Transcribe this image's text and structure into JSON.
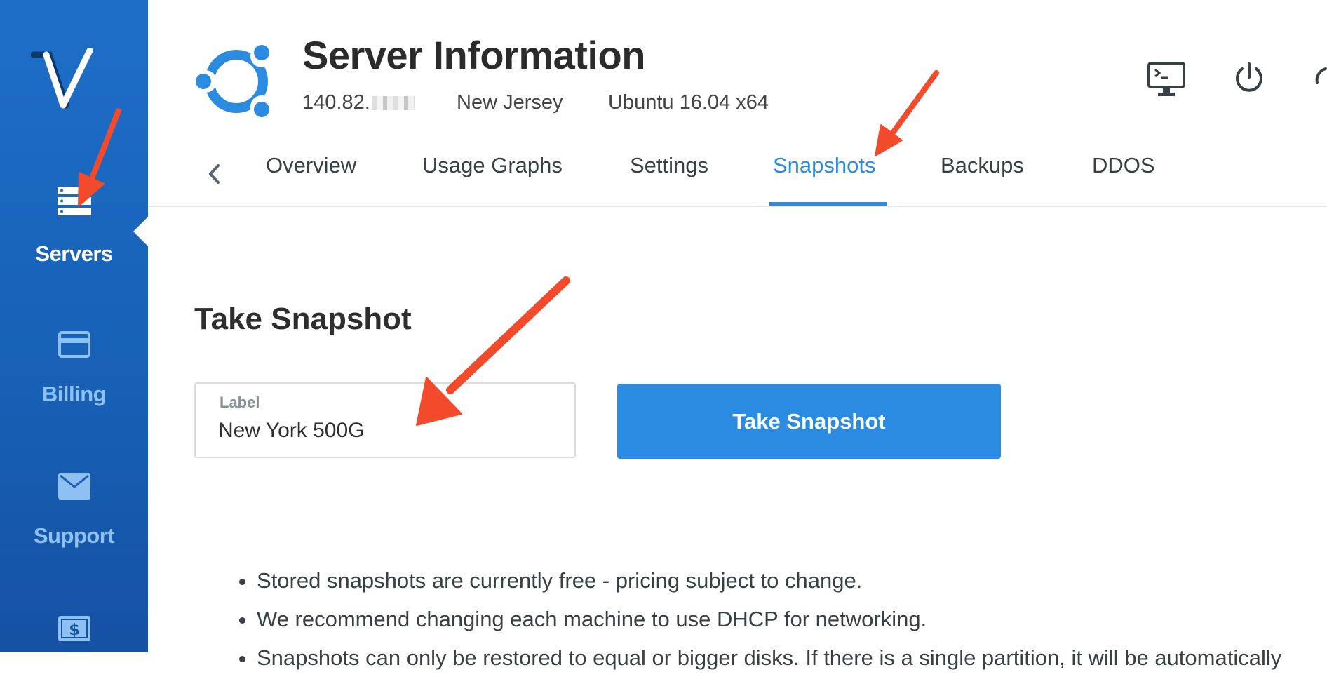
{
  "sidebar": {
    "logo": "vultr-logo",
    "items": [
      {
        "label": "Servers",
        "icon": "server-stack-icon",
        "active": true
      },
      {
        "label": "Billing",
        "icon": "credit-card-icon",
        "active": false
      },
      {
        "label": "Support",
        "icon": "envelope-icon",
        "active": false
      },
      {
        "label": "",
        "icon": "dollar-bill-icon",
        "active": false
      }
    ]
  },
  "header": {
    "os_icon": "ubuntu-logo-icon",
    "title": "Server Information",
    "ip": "140.82.",
    "location": "New Jersey",
    "os": "Ubuntu 16.04 x64",
    "actions": [
      "console-icon",
      "power-icon",
      "restart-icon"
    ]
  },
  "tabs": [
    {
      "label": "Overview",
      "active": false
    },
    {
      "label": "Usage Graphs",
      "active": false
    },
    {
      "label": "Settings",
      "active": false
    },
    {
      "label": "Snapshots",
      "active": true
    },
    {
      "label": "Backups",
      "active": false
    },
    {
      "label": "DDOS",
      "active": false
    }
  ],
  "snapshot": {
    "title": "Take Snapshot",
    "label_caption": "Label",
    "label_value": "New York 500G",
    "button_label": "Take Snapshot"
  },
  "notes": [
    "Stored snapshots are currently free - pricing subject to change.",
    "We recommend changing each machine to use DHCP for networking.",
    "Snapshots can only be restored to equal or bigger disks. If there is a single partition, it will be automatically"
  ],
  "colors": {
    "accent": "#2b8be0",
    "sidebar": "#1760b5",
    "annotation": "#f24a2a"
  }
}
